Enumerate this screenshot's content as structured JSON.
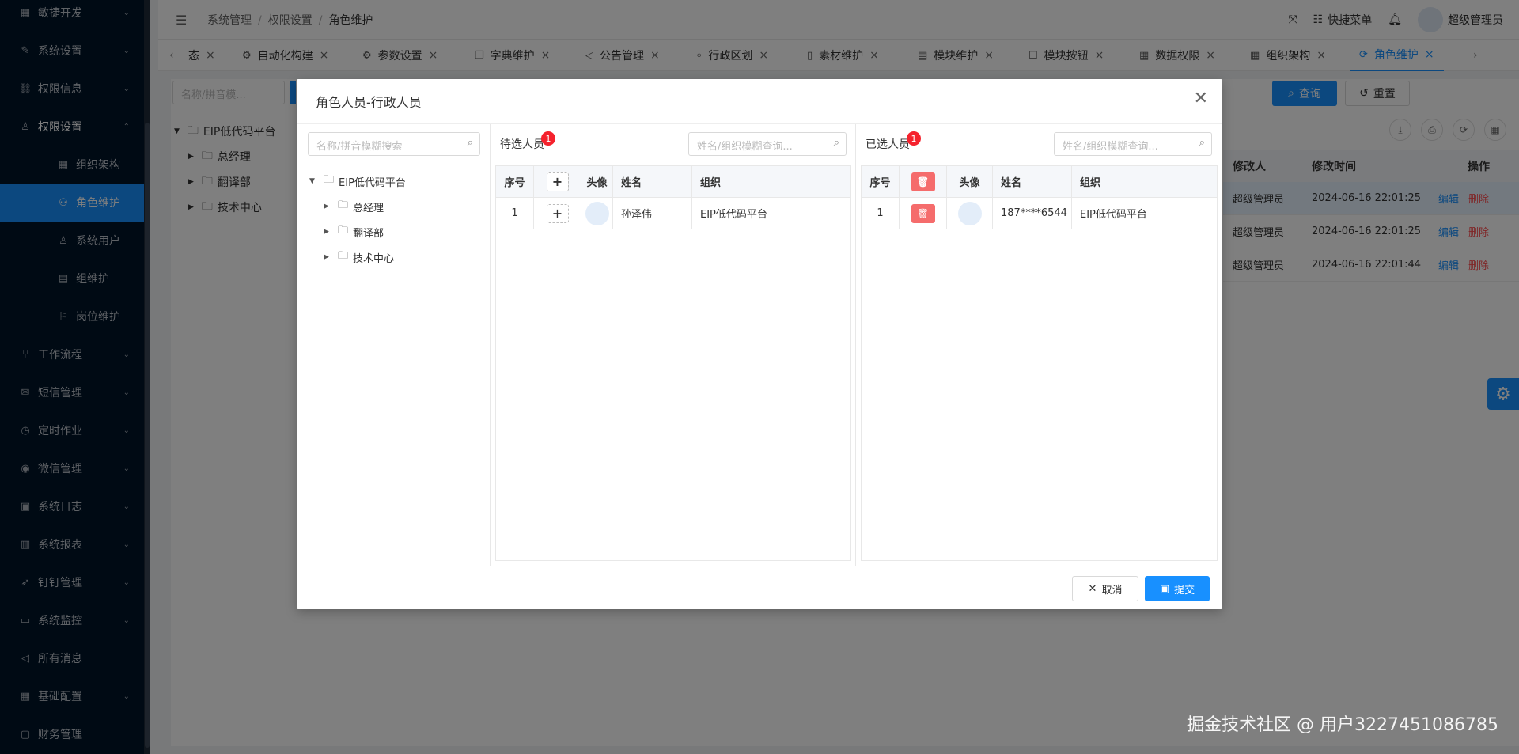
{
  "sidebar": {
    "items": [
      {
        "label": "敏捷开发",
        "icon": "grid-icon",
        "type": "parent"
      },
      {
        "label": "系统设置",
        "icon": "wrench-icon",
        "type": "parent"
      },
      {
        "label": "权限信息",
        "icon": "link-icon",
        "type": "parent"
      },
      {
        "label": "权限设置",
        "icon": "user-icon",
        "type": "open"
      },
      {
        "label": "组织架构",
        "icon": "grid-icon",
        "type": "sub"
      },
      {
        "label": "角色维护",
        "icon": "users-icon",
        "type": "active"
      },
      {
        "label": "系统用户",
        "icon": "user-icon",
        "type": "sub"
      },
      {
        "label": "组维护",
        "icon": "table-icon",
        "type": "sub"
      },
      {
        "label": "岗位维护",
        "icon": "badge-icon",
        "type": "sub"
      },
      {
        "label": "工作流程",
        "icon": "branch-icon",
        "type": "parent"
      },
      {
        "label": "短信管理",
        "icon": "sms-icon",
        "type": "parent"
      },
      {
        "label": "定时作业",
        "icon": "clock-icon",
        "type": "parent"
      },
      {
        "label": "微信管理",
        "icon": "wechat-icon",
        "type": "parent"
      },
      {
        "label": "系统日志",
        "icon": "log-icon",
        "type": "parent"
      },
      {
        "label": "系统报表",
        "icon": "chart-icon",
        "type": "parent"
      },
      {
        "label": "钉钉管理",
        "icon": "dingtalk-icon",
        "type": "parent"
      },
      {
        "label": "系统监控",
        "icon": "monitor-icon",
        "type": "parent"
      },
      {
        "label": "所有消息",
        "icon": "megaphone-icon",
        "type": "leaf"
      },
      {
        "label": "基础配置",
        "icon": "grid-icon",
        "type": "parent-root"
      },
      {
        "label": "财务管理",
        "icon": "finance-icon",
        "type": "leaf-root"
      }
    ]
  },
  "header": {
    "breadcrumb": [
      "系统管理",
      "权限设置",
      "角色维护"
    ],
    "quick_menu": "快捷菜单",
    "user": "超级管理员"
  },
  "tabs": [
    {
      "label": "态",
      "icon": ""
    },
    {
      "label": "自动化构建",
      "icon": "robot-icon"
    },
    {
      "label": "参数设置",
      "icon": "gear-icon"
    },
    {
      "label": "字典维护",
      "icon": "copy-icon"
    },
    {
      "label": "公告管理",
      "icon": "megaphone-icon"
    },
    {
      "label": "行政区划",
      "icon": "location-icon"
    },
    {
      "label": "素材维护",
      "icon": "file-icon"
    },
    {
      "label": "模块维护",
      "icon": "book-icon"
    },
    {
      "label": "模块按钮",
      "icon": "square-icon"
    },
    {
      "label": "数据权限",
      "icon": "table-icon"
    },
    {
      "label": "组织架构",
      "icon": "grid-icon"
    },
    {
      "label": "角色维护",
      "icon": "refresh-icon",
      "active": true
    }
  ],
  "background": {
    "search_placeholder": "名称/拼音模...",
    "tree": [
      "EIP低代码平台",
      "总经理",
      "翻译部",
      "技术中心"
    ],
    "query": "查询",
    "reset": "重置",
    "table": {
      "headers": [
        "修改人",
        "修改时间",
        "操作"
      ],
      "rows": [
        {
          "modifier": "超级管理员",
          "time": "2024-06-16 22:01:25"
        },
        {
          "modifier": "超级管理员",
          "time": "2024-06-16 22:01:25"
        },
        {
          "modifier": "超级管理员",
          "time": "2024-06-16 22:01:44"
        }
      ],
      "edit": "编辑",
      "delete": "删除"
    }
  },
  "modal": {
    "title": "角色人员-行政人员",
    "left": {
      "search_placeholder": "名称/拼音模糊搜索",
      "tree_root": "EIP低代码平台",
      "tree_children": [
        "总经理",
        "翻译部",
        "技术中心"
      ]
    },
    "pending": {
      "title": "待选人员",
      "count": "1",
      "search_placeholder": "姓名/组织模糊查询...",
      "headers": [
        "序号",
        "头像",
        "姓名",
        "组织"
      ],
      "rows": [
        {
          "index": "1",
          "name": "孙泽伟",
          "org": "EIP低代码平台"
        }
      ]
    },
    "selected": {
      "title": "已选人员",
      "count": "1",
      "search_placeholder": "姓名/组织模糊查询...",
      "headers": [
        "序号",
        "头像",
        "姓名",
        "组织"
      ],
      "rows": [
        {
          "index": "1",
          "name": "187****6544",
          "org": "EIP低代码平台"
        }
      ]
    },
    "cancel": "取消",
    "submit": "提交"
  },
  "watermark": "掘金技术社区 @ 用户3227451086785"
}
